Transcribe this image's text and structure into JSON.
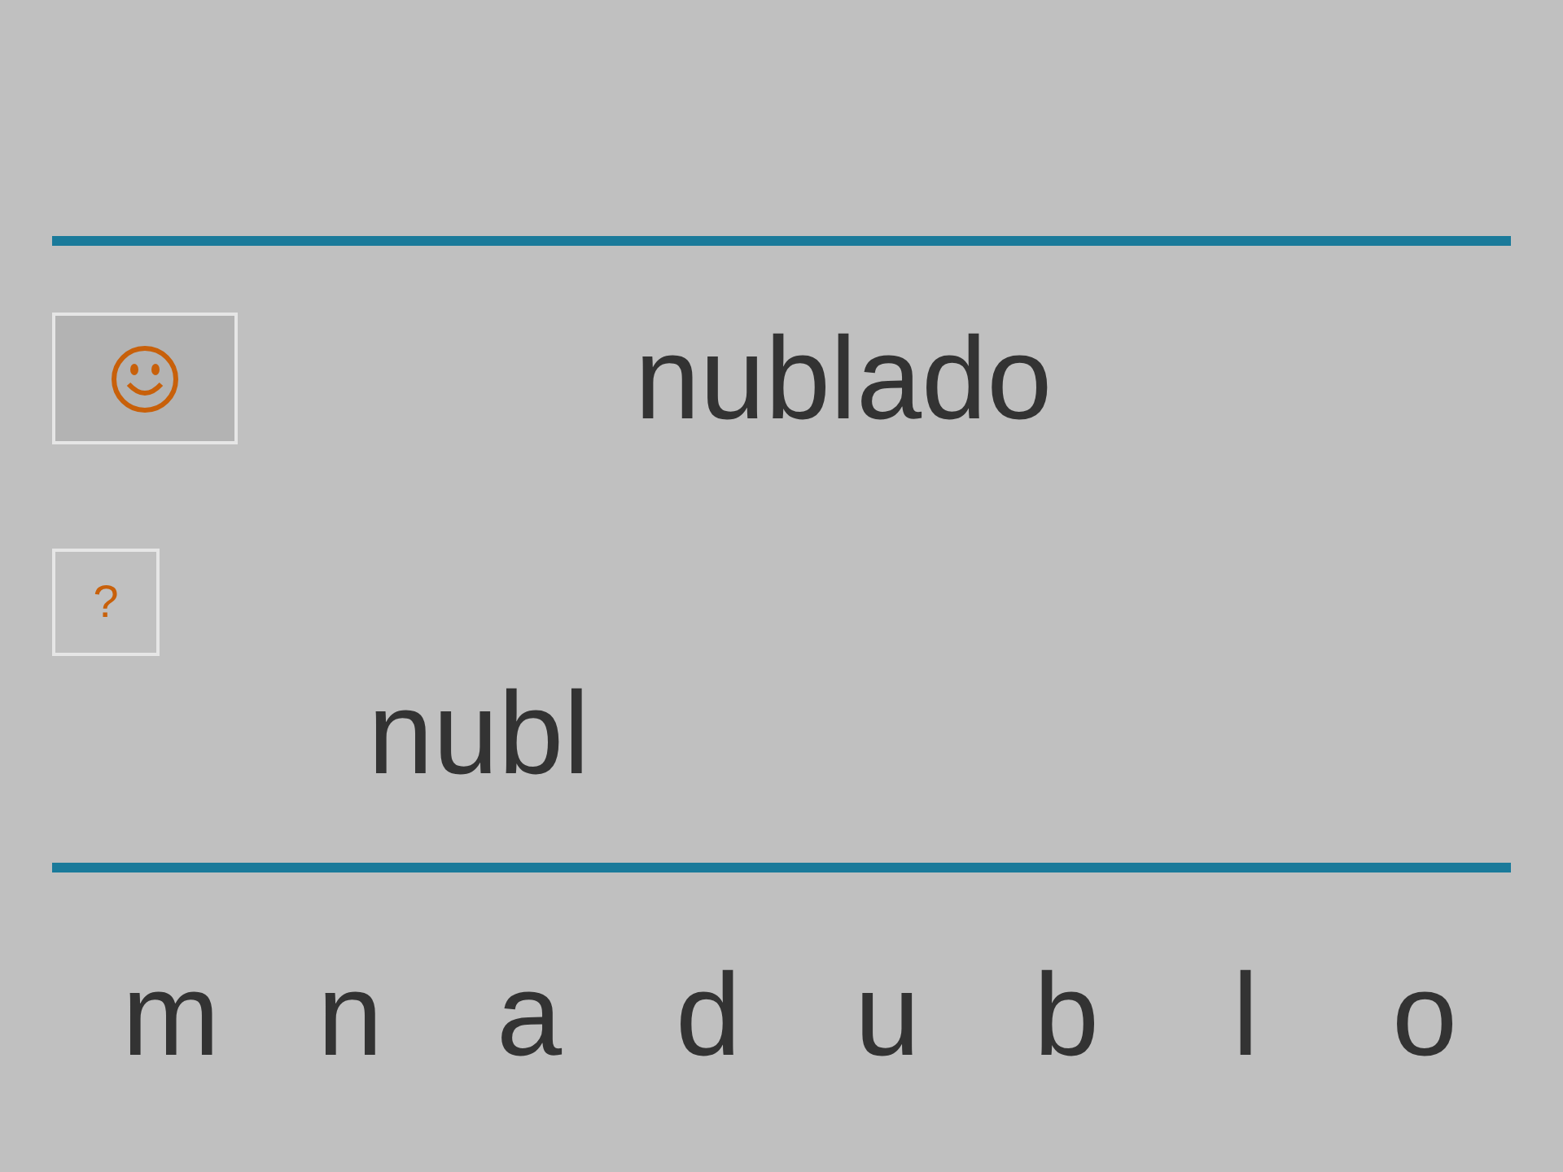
{
  "target_word": "nublado",
  "hint_button": {
    "label": "?"
  },
  "answer": "nubl",
  "letters": [
    "m",
    "n",
    "a",
    "d",
    "u",
    "b",
    "l",
    "o"
  ]
}
